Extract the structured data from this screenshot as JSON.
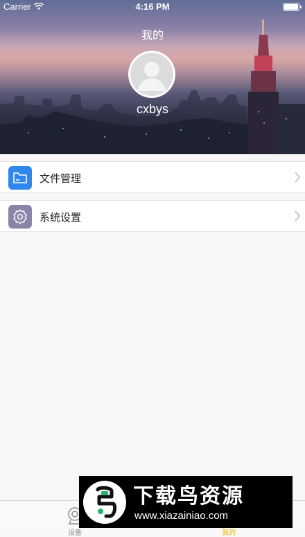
{
  "status_bar": {
    "carrier": "Carrier",
    "time": "4:16 PM"
  },
  "header": {
    "title": "我的",
    "username": "cxbys"
  },
  "menu": [
    {
      "label": "文件管理",
      "icon": "folder-icon",
      "icon_color": "#2f86ec"
    },
    {
      "label": "系统设置",
      "icon": "gear-icon",
      "icon_color": "#8a84ab"
    }
  ],
  "tabbar": {
    "tabs": [
      {
        "label": "设备",
        "icon": "camera-icon",
        "active": false
      },
      {
        "label": "我的",
        "icon": "profile-icon",
        "active": true
      }
    ],
    "active_color": "#f2b400",
    "inactive_color": "#8e8e8e"
  },
  "watermark": {
    "title": "下载鸟资源",
    "url": "www.xiazainiao.com"
  }
}
